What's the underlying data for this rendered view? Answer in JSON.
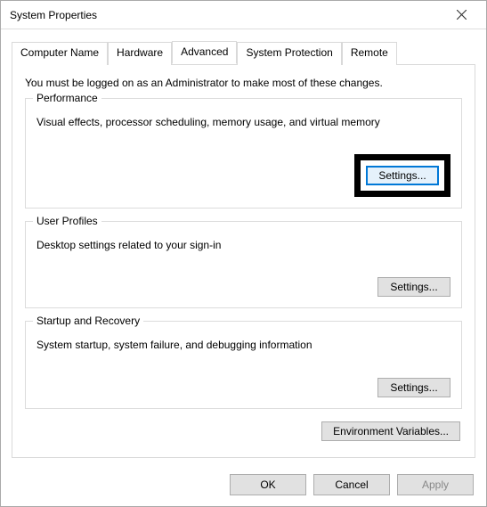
{
  "window": {
    "title": "System Properties"
  },
  "tabs": {
    "computer_name": "Computer Name",
    "hardware": "Hardware",
    "advanced": "Advanced",
    "system_protection": "System Protection",
    "remote": "Remote"
  },
  "panel": {
    "intro": "You must be logged on as an Administrator to make most of these changes.",
    "performance": {
      "title": "Performance",
      "desc": "Visual effects, processor scheduling, memory usage, and virtual memory",
      "button": "Settings..."
    },
    "user_profiles": {
      "title": "User Profiles",
      "desc": "Desktop settings related to your sign-in",
      "button": "Settings..."
    },
    "startup": {
      "title": "Startup and Recovery",
      "desc": "System startup, system failure, and debugging information",
      "button": "Settings..."
    },
    "env_vars_button": "Environment Variables..."
  },
  "footer": {
    "ok": "OK",
    "cancel": "Cancel",
    "apply": "Apply"
  }
}
